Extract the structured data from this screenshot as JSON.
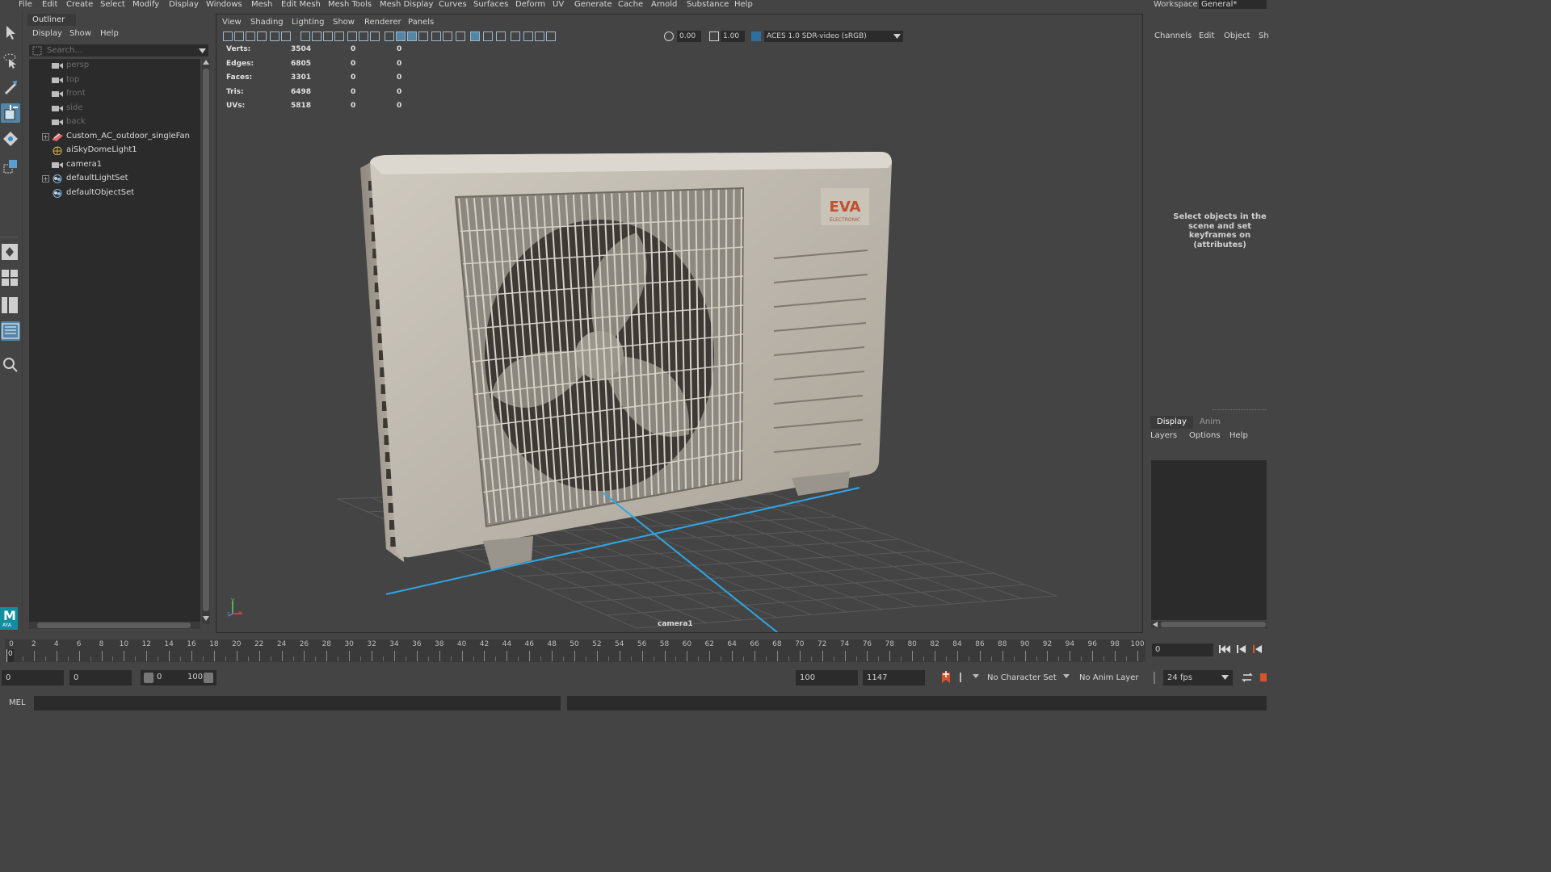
{
  "menubar": {
    "items": [
      "File",
      "Edit",
      "Create",
      "Select",
      "Modify",
      "Display",
      "Windows",
      "Mesh",
      "Edit Mesh",
      "Mesh Tools",
      "Mesh Display",
      "Curves",
      "Surfaces",
      "Deform",
      "UV",
      "Generate",
      "Cache",
      "Arnold",
      "Substance",
      "Help"
    ],
    "workspace_label": "Workspace:",
    "workspace_value": "General*"
  },
  "toolbox": {
    "tools": [
      "select-tool",
      "lasso-tool",
      "paint-select-tool",
      "move-tool",
      "rotate-tool",
      "scale-tool",
      "single-perspective-layout",
      "four-view-layout",
      "persp-outliner-layout",
      "outliner-layout",
      "search-tool"
    ],
    "logo_letter": "M",
    "badge_letter": "M",
    "badge_text": "AYA"
  },
  "outliner": {
    "tab": "Outliner",
    "menu": [
      "Display",
      "Show",
      "Help"
    ],
    "search_placeholder": "Search...",
    "items": [
      {
        "label": "persp",
        "icon": "camera-icon",
        "dim": true,
        "expandable": false
      },
      {
        "label": "top",
        "icon": "camera-icon",
        "dim": true,
        "expandable": false
      },
      {
        "label": "front",
        "icon": "camera-icon",
        "dim": true,
        "expandable": false
      },
      {
        "label": "side",
        "icon": "camera-icon",
        "dim": true,
        "expandable": false
      },
      {
        "label": "back",
        "icon": "camera-icon",
        "dim": true,
        "expandable": false
      },
      {
        "label": "Custom_AC_outdoor_singleFan",
        "icon": "mesh-group-icon",
        "dim": false,
        "expandable": true
      },
      {
        "label": "aiSkyDomeLight1",
        "icon": "skydome-light-icon",
        "dim": false,
        "expandable": false
      },
      {
        "label": "camera1",
        "icon": "camera-icon",
        "dim": false,
        "expandable": false
      },
      {
        "label": "defaultLightSet",
        "icon": "set-icon",
        "dim": false,
        "expandable": true
      },
      {
        "label": "defaultObjectSet",
        "icon": "set-icon",
        "dim": false,
        "expandable": false
      }
    ]
  },
  "viewport": {
    "menu": [
      "View",
      "Shading",
      "Lighting",
      "Show",
      "Renderer",
      "Panels"
    ],
    "exposure": "0.00",
    "gamma": "1.00",
    "color_space": "ACES 1.0 SDR-video (sRGB)",
    "hud": [
      {
        "label": "Verts:",
        "a": "3504",
        "b": "0",
        "c": "0"
      },
      {
        "label": "Edges:",
        "a": "6805",
        "b": "0",
        "c": "0"
      },
      {
        "label": "Faces:",
        "a": "3301",
        "b": "0",
        "c": "0"
      },
      {
        "label": "Tris:",
        "a": "6498",
        "b": "0",
        "c": "0"
      },
      {
        "label": "UVs:",
        "a": "5818",
        "b": "0",
        "c": "0"
      }
    ],
    "camera_label": "camera1",
    "model_brand": "EVA",
    "model_brand_sub": "ELECTRONIC",
    "axis_y": "y",
    "axis_x": "x",
    "axis_z": "z"
  },
  "channel_box": {
    "menu": [
      "Channels",
      "Edit",
      "Object",
      "Sh"
    ],
    "message": "Select objects in the scene and set keyframes on (attributes)"
  },
  "layer_editor": {
    "tabs": [
      "Display",
      "Anim"
    ],
    "menu": [
      "Layers",
      "Options",
      "Help"
    ]
  },
  "timeline": {
    "ticks": [
      "0",
      "2",
      "4",
      "6",
      "8",
      "10",
      "12",
      "14",
      "16",
      "18",
      "20",
      "22",
      "24",
      "26",
      "28",
      "30",
      "32",
      "34",
      "36",
      "38",
      "40",
      "42",
      "44",
      "46",
      "48",
      "50",
      "52",
      "54",
      "56",
      "58",
      "60",
      "62",
      "64",
      "66",
      "68",
      "70",
      "72",
      "74",
      "76",
      "78",
      "80",
      "82",
      "84",
      "86",
      "88",
      "90",
      "92",
      "94",
      "96",
      "98",
      "100"
    ],
    "current_marker": "0",
    "current_frame": "0"
  },
  "range": {
    "start_time": "0",
    "playback_start": "0",
    "slider_start": "0",
    "slider_end": "100",
    "playback_end": "100",
    "end_time": "1147",
    "character_set": "No Character Set",
    "anim_layer": "No Anim Layer",
    "fps": "24 fps"
  },
  "cmdline": {
    "label": "MEL"
  },
  "colors": {
    "accent": "#5285a6",
    "grid_axis": "#2ea6e6",
    "maya_logo_dark": "#0f8f9e",
    "maya_logo_light": "#6fd3e0",
    "key_red": "#d9532a"
  }
}
